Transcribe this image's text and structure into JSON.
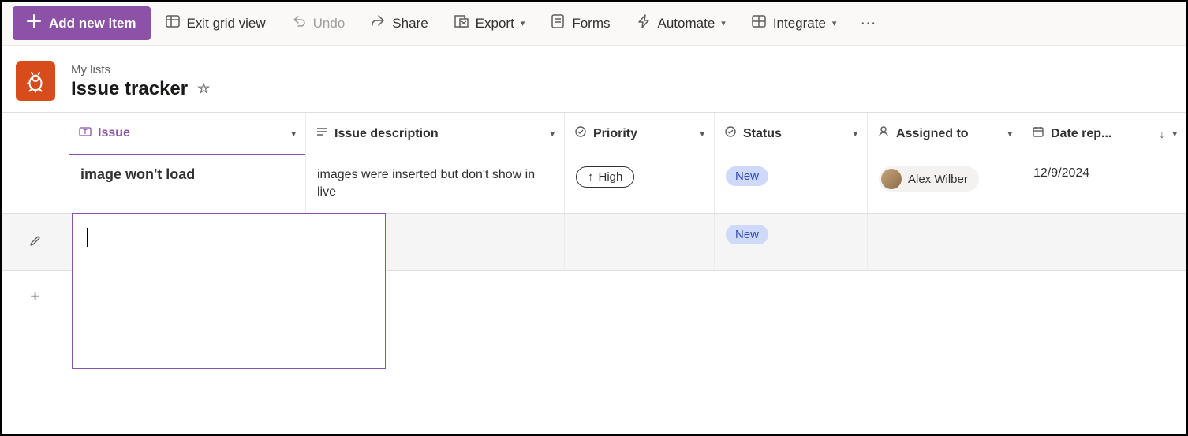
{
  "toolbar": {
    "add_new_item": "Add new item",
    "exit_grid": "Exit grid view",
    "undo": "Undo",
    "share": "Share",
    "export": "Export",
    "forms": "Forms",
    "automate": "Automate",
    "integrate": "Integrate"
  },
  "header": {
    "breadcrumb": "My lists",
    "title": "Issue tracker"
  },
  "columns": {
    "issue": "Issue",
    "description": "Issue description",
    "priority": "Priority",
    "status": "Status",
    "assigned": "Assigned to",
    "date": "Date rep..."
  },
  "rows": [
    {
      "issue": "image won't load",
      "description": "images were inserted but don't show in live",
      "priority": "High",
      "status": "New",
      "assigned": "Alex Wilber",
      "date": "12/9/2024"
    }
  ],
  "editing_row": {
    "status": "New"
  },
  "icons": {
    "plus": "+",
    "star": "☆",
    "pencil": "✎",
    "arrow_up": "↑",
    "arrow_down": "↓"
  },
  "colors": {
    "primary": "#8b52a8",
    "list_icon_bg": "#d84b1a",
    "status_bg": "#cfd9f9",
    "status_fg": "#3249b8"
  }
}
